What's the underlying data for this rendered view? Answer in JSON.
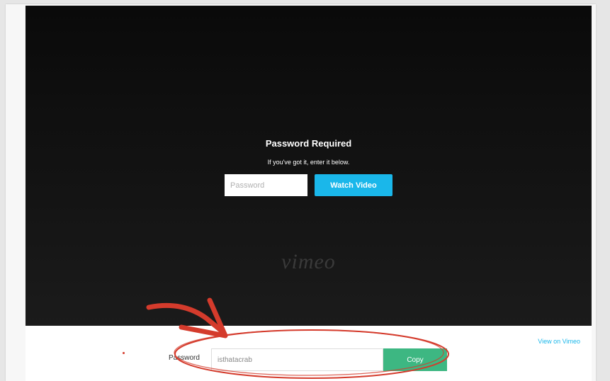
{
  "player": {
    "title": "Password Required",
    "subtitle": "If you've got it, enter it below.",
    "password_placeholder": "Password",
    "watch_button": "Watch Video",
    "logo": "vimeo"
  },
  "footer": {
    "view_link": "View on Vimeo",
    "password_label": "Password",
    "password_value": "isthatacrab",
    "copy_button": "Copy"
  },
  "colors": {
    "vimeo_blue": "#1ab7ea",
    "copy_green": "#3db782",
    "annotation_red": "#d43b2c"
  },
  "icons": [
    "arrow-annotation",
    "circle-annotation"
  ]
}
